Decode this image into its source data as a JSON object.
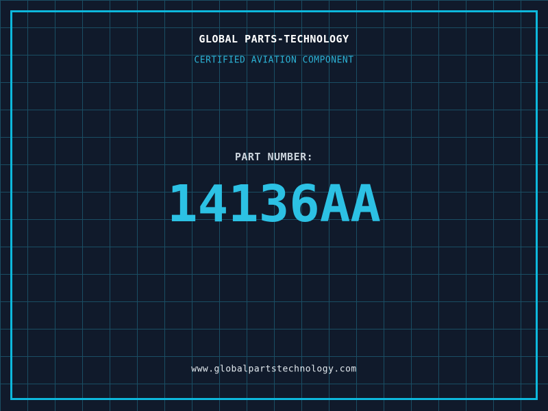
{
  "header": {
    "title": "GLOBAL PARTS-TECHNOLOGY",
    "subtitle": "CERTIFIED AVIATION COMPONENT"
  },
  "part": {
    "label": "PART NUMBER:",
    "number": "14136AA"
  },
  "footer": {
    "website": "www.globalpartstechnology.com"
  },
  "colors": {
    "background": "#101a2b",
    "grid_line": "#1a4e64",
    "frame": "#0db8dc",
    "title_text": "#ffffff",
    "subtitle_text": "#2cb3d6",
    "label_text": "#cbd4dc",
    "part_number_text": "#2cc1e4",
    "footer_text": "#e2e9ee"
  },
  "layout_meta": {
    "grid_spacing_px": "40"
  }
}
